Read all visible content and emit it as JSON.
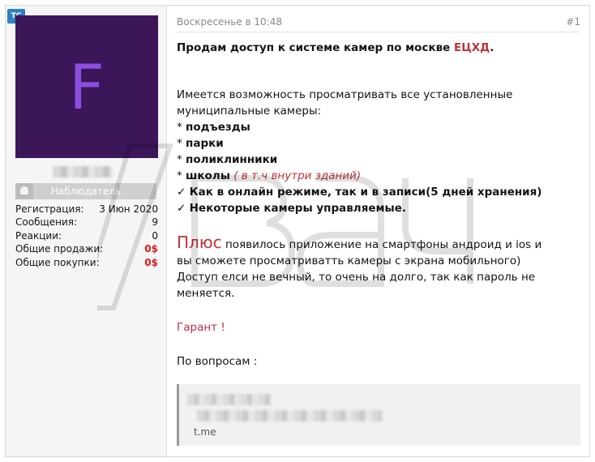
{
  "badge": "ТС",
  "user": {
    "avatar_letter": "F",
    "role": "Наблюдатель",
    "stats": [
      {
        "label": "Регистрация:",
        "value": "3 Июн 2020",
        "highlight": false
      },
      {
        "label": "Сообщения:",
        "value": "9",
        "highlight": false
      },
      {
        "label": "Реакции:",
        "value": "0",
        "highlight": false
      },
      {
        "label": "Общие продажи:",
        "value": "0$",
        "highlight": true
      },
      {
        "label": "Общие покупки:",
        "value": "0$",
        "highlight": true
      }
    ]
  },
  "post": {
    "date": "Воскресенье в 10:48",
    "number": "#1",
    "title_text": "Продам доступ к системе камер по москве ",
    "title_accent": "ЕЦХД",
    "title_end": ".",
    "intro_line1": "Имеется возможность просматривать все установленные",
    "intro_line2": "муниципальные камеры:",
    "bullet_mark": "*",
    "check_mark": "✓",
    "items": {
      "entrances": "подъезды",
      "parks": "парки",
      "clinics": "поликлинники",
      "schools": "школы",
      "schools_note": "( в т.ч внутри зданий)"
    },
    "features": {
      "online": "Как в онлайн режиме, так и в записи(5 дней хранения)",
      "controllable": "Некоторые камеры управляемые."
    },
    "plus_word": "Плюс",
    "plus_rest": " появилось приложение на смартфоны андроид и ios и",
    "plus_line2": "вы сможете просматриватть камеры с экрана мобильного)",
    "access_line1": "Доступ елси не вечный, то очень на долго, так как пароль не",
    "access_line2": "меняется.",
    "guarantee": "Гарант !",
    "contact": "По вопросам :",
    "link": "t.me"
  },
  "colors": {
    "accent_red": "#c2323a",
    "avatar_bg": "#3b1658",
    "avatar_letter": "#8a4ee0",
    "badge_blue": "#2f7fc1"
  }
}
